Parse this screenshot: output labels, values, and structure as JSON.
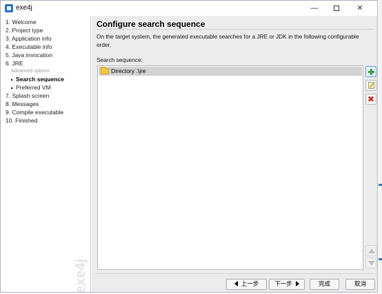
{
  "window": {
    "title": "exe4j",
    "minimize_glyph": "—",
    "close_glyph": "✕"
  },
  "sidebar": {
    "steps": [
      {
        "label": "1. Welcome"
      },
      {
        "label": "2. Project type"
      },
      {
        "label": "3. Application info"
      },
      {
        "label": "4. Executable info"
      },
      {
        "label": "5. Java invocation"
      },
      {
        "label": "6. JRE"
      },
      {
        "label": "Advanced options"
      },
      {
        "label": "Search sequence",
        "active": true
      },
      {
        "label": "Preferred VM"
      },
      {
        "label": "7. Splash screen"
      },
      {
        "label": "8. Messages"
      },
      {
        "label": "9. Compile executable"
      },
      {
        "label": "10. Finished"
      }
    ],
    "watermark": "exe4j"
  },
  "main": {
    "title": "Configure search sequence",
    "description": "On the target system, the generated executable searches for a JRE or JDK in the following configurable order.",
    "sequence_label": "Search sequence:",
    "sequence_items": [
      {
        "label": "Directory .\\jre",
        "icon": "folder-icon"
      }
    ]
  },
  "footer": {
    "back_label": "上一步",
    "next_label": "下一步",
    "finish_label": "完成",
    "cancel_label": "取消"
  },
  "colors": {
    "panel_bg": "#ececec",
    "selected_row": "#d2d2d2",
    "add_icon": "#3aa13a",
    "remove_icon": "#d42b1e",
    "folder": "#f5c543"
  }
}
